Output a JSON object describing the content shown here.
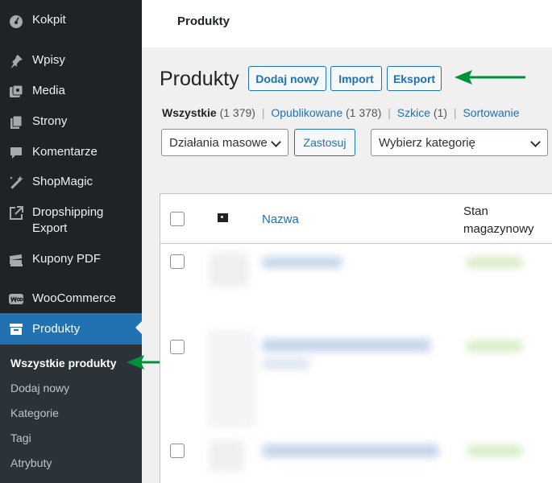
{
  "sidebar": {
    "items": [
      {
        "label": "Kokpit",
        "icon": "dashboard-icon"
      },
      {
        "label": "Wpisy",
        "icon": "pin-icon"
      },
      {
        "label": "Media",
        "icon": "media-icon"
      },
      {
        "label": "Strony",
        "icon": "pages-icon"
      },
      {
        "label": "Komentarze",
        "icon": "comment-icon"
      },
      {
        "label": "ShopMagic",
        "icon": "magic-wand-icon"
      },
      {
        "label": "Dropshipping\nExport",
        "icon": "export-icon"
      },
      {
        "label": "Kupony PDF",
        "icon": "coupons-icon"
      },
      {
        "label": "WooCommerce",
        "icon": "woocommerce-icon"
      },
      {
        "label": "Produkty",
        "icon": "archive-icon"
      }
    ],
    "submenu": [
      {
        "label": "Wszystkie produkty"
      },
      {
        "label": "Dodaj nowy"
      },
      {
        "label": "Kategorie"
      },
      {
        "label": "Tagi"
      },
      {
        "label": "Atrybuty"
      }
    ]
  },
  "topbar": {
    "title": "Produkty"
  },
  "page": {
    "title": "Produkty",
    "buttons": {
      "add_new": "Dodaj nowy",
      "import": "Import",
      "export": "Eksport"
    }
  },
  "filters": {
    "all_label": "Wszystkie",
    "all_count": "(1 379)",
    "published_label": "Opublikowane",
    "published_count": "(1 378)",
    "drafts_label": "Szkice",
    "drafts_count": "(1)",
    "sorting_label": "Sortowanie",
    "separator": "|"
  },
  "bulk": {
    "actions_value": "Działania masowe",
    "apply_label": "Zastosuj",
    "category_value": "Wybierz kategorię"
  },
  "table": {
    "col_name": "Nazwa",
    "col_stock_line1": "Stan",
    "col_stock_line2": "magazynowy"
  },
  "colors": {
    "sidebar_bg": "#1d2327",
    "accent": "#2271b1",
    "arrow": "#00913a"
  }
}
